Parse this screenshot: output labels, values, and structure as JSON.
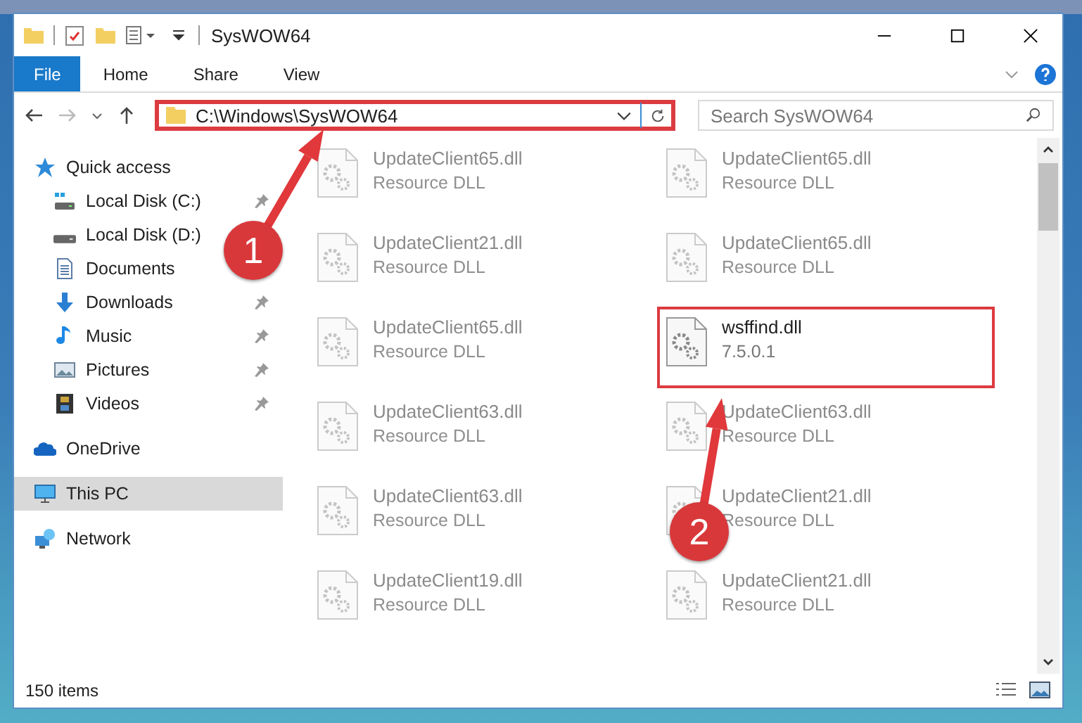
{
  "window": {
    "title": "SysWOW64"
  },
  "ribbon": {
    "tabs": [
      {
        "label": "File",
        "kind": "file",
        "selected": false
      },
      {
        "label": "Home",
        "kind": "plain",
        "selected": false
      },
      {
        "label": "Share",
        "kind": "plain",
        "selected": false
      },
      {
        "label": "View",
        "kind": "plain",
        "selected": false
      }
    ]
  },
  "address": {
    "path": "C:\\Windows\\SysWOW64",
    "highlighted": true
  },
  "search": {
    "placeholder": "Search SysWOW64"
  },
  "sidebar": {
    "items": [
      {
        "label": "Quick access",
        "kind": "star",
        "selected": false,
        "children": [
          {
            "label": "Local Disk (C:)",
            "kind": "systemdrive",
            "pinned": true,
            "selected": false
          },
          {
            "label": "Local Disk (D:)",
            "kind": "drive",
            "selected": false
          },
          {
            "label": "Documents",
            "kind": "document",
            "selected": false
          },
          {
            "label": "Downloads",
            "kind": "download",
            "pinned": true,
            "selected": false
          },
          {
            "label": "Music",
            "kind": "music",
            "pinned": true,
            "selected": false
          },
          {
            "label": "Pictures",
            "kind": "pictures",
            "pinned": true,
            "selected": false
          },
          {
            "label": "Videos",
            "kind": "videos",
            "pinned": true,
            "selected": false
          }
        ]
      },
      {
        "label": "OneDrive",
        "kind": "cloud",
        "selected": false
      },
      {
        "label": "This PC",
        "kind": "computer",
        "selected": true
      },
      {
        "label": "Network",
        "kind": "network",
        "selected": false
      }
    ]
  },
  "files": [
    {
      "name": "UpdateClient65.dll",
      "detail": "Resource DLL",
      "kind": "faded"
    },
    {
      "name": "UpdateClient65.dll",
      "detail": "Resource DLL",
      "kind": "faded"
    },
    {
      "name": "UpdateClient21.dll",
      "detail": "Resource DLL",
      "kind": "faded"
    },
    {
      "name": "UpdateClient65.dll",
      "detail": "Resource DLL",
      "kind": "faded"
    },
    {
      "name": "UpdateClient65.dll",
      "detail": "Resource DLL",
      "kind": "faded"
    },
    {
      "name": "wsffind.dll",
      "detail": "7.5.0.1",
      "kind": "highlighted"
    },
    {
      "name": "UpdateClient63.dll",
      "detail": "Resource DLL",
      "kind": "faded"
    },
    {
      "name": "UpdateClient63.dll",
      "detail": "Resource DLL",
      "kind": "faded"
    },
    {
      "name": "UpdateClient63.dll",
      "detail": "Resource DLL",
      "kind": "faded"
    },
    {
      "name": "UpdateClient21.dll",
      "detail": "Resource DLL",
      "kind": "faded"
    },
    {
      "name": "UpdateClient19.dll",
      "detail": "Resource DLL",
      "kind": "faded"
    },
    {
      "name": "UpdateClient21.dll",
      "detail": "Resource DLL",
      "kind": "faded"
    }
  ],
  "annotations": [
    {
      "number": "1"
    },
    {
      "number": "2"
    }
  ],
  "status_bar": {
    "count": "150 items"
  }
}
